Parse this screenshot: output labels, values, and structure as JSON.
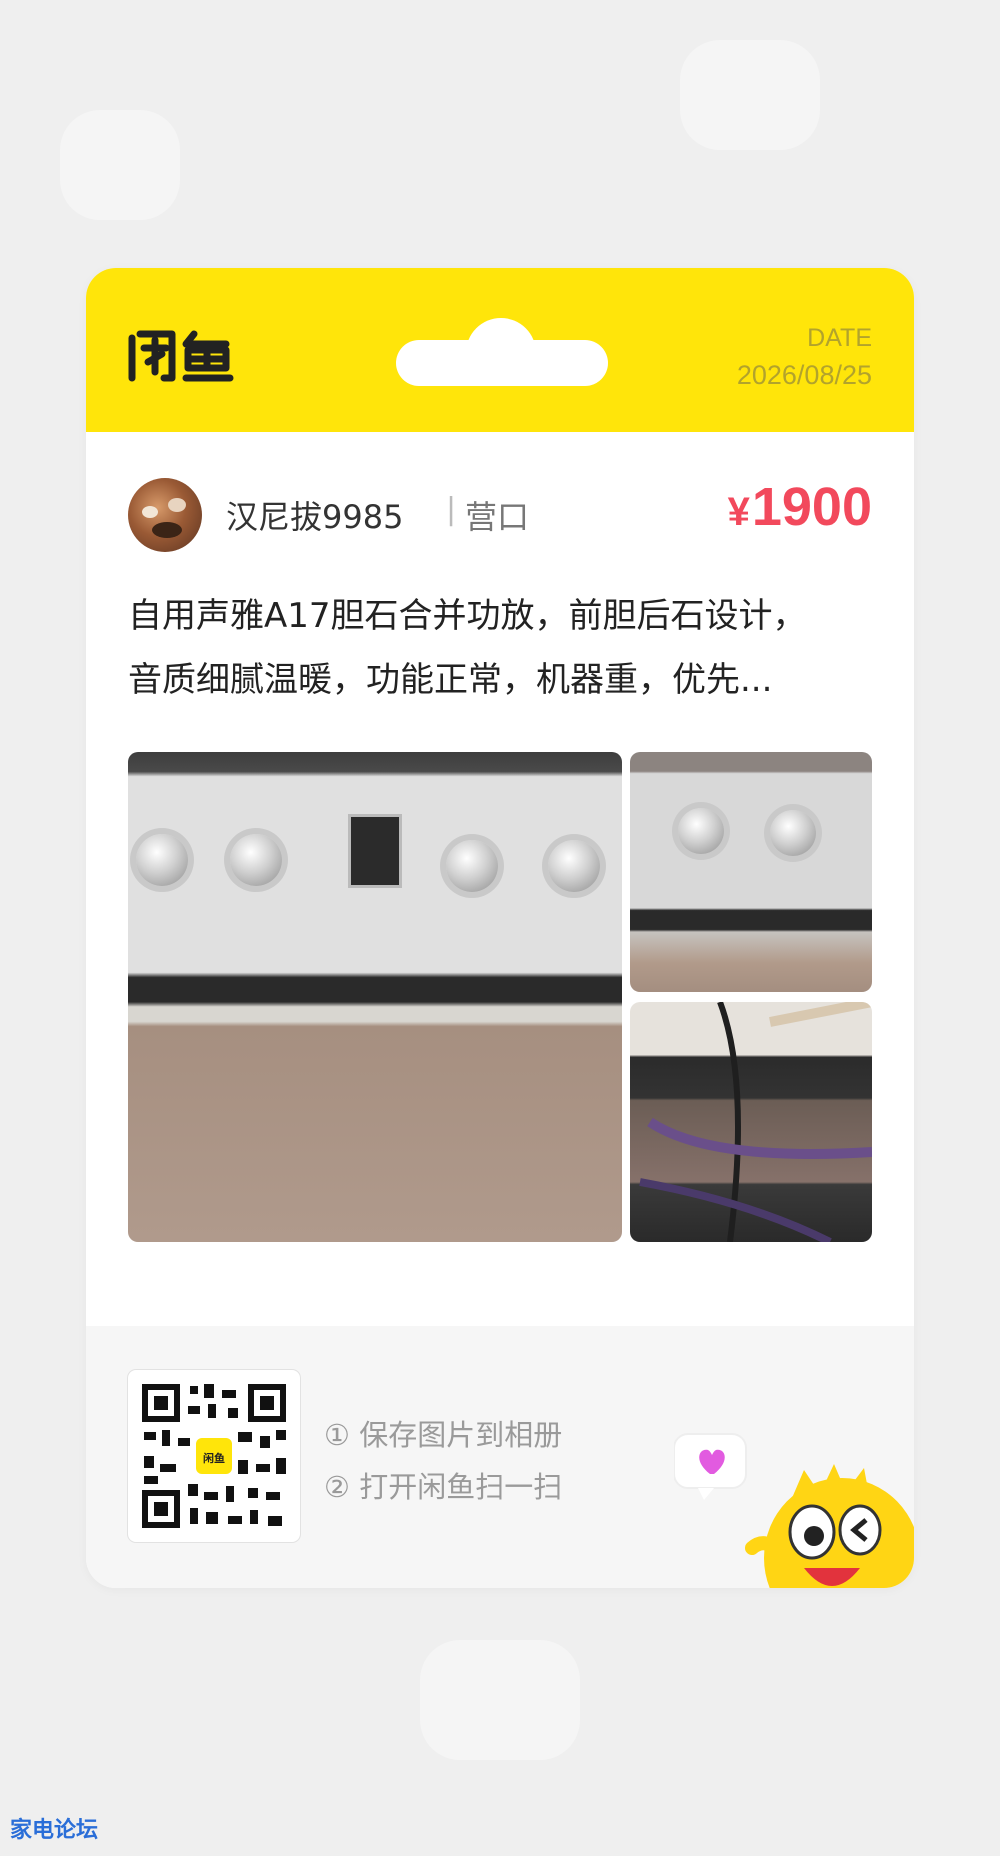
{
  "header": {
    "brand": "闲鱼",
    "date_label": "DATE",
    "date_value": "2026/08/25"
  },
  "seller": {
    "name": "汉尼拔9985",
    "separator": "|",
    "location": "营口"
  },
  "price": {
    "currency": "¥",
    "amount": "1900"
  },
  "description": {
    "line1": "自用声雅A17胆石合并功放，前胆后石设计，",
    "line2": "音质细腻温暖，功能正常，机器重，优先..."
  },
  "footer": {
    "step1": "① 保存图片到相册",
    "step2": "② 打开闲鱼扫一扫",
    "qr_center_label": "闲鱼"
  },
  "watermark": "家电论坛",
  "colors": {
    "brand_yellow": "#FFE50A",
    "price_red": "#f2495c"
  },
  "icons": [
    "xianyu-logo-icon",
    "qr-code-icon",
    "heart-bubble-icon",
    "mascot-icon"
  ]
}
